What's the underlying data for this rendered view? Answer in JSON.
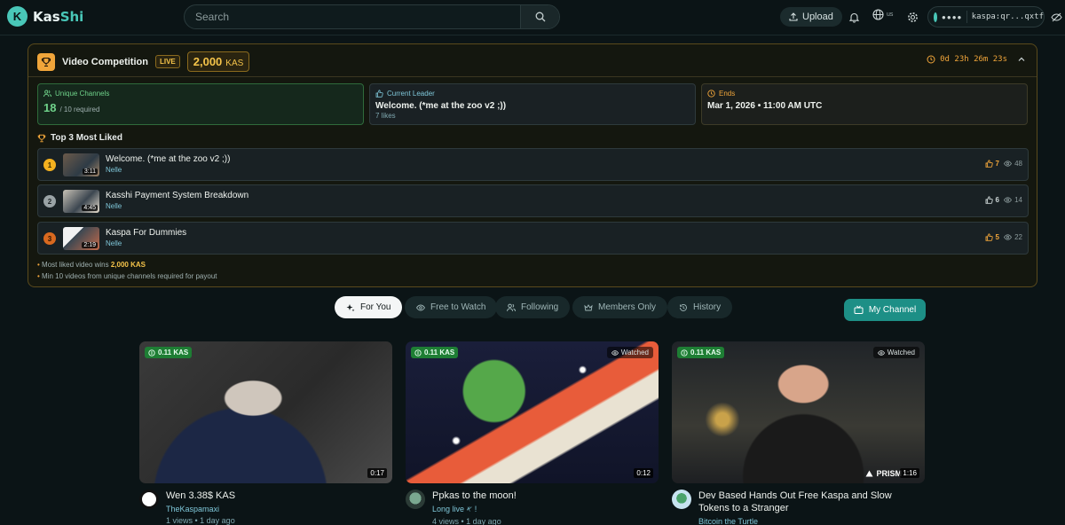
{
  "app": {
    "name_part1": "Kas",
    "name_part2": "Shi",
    "accent": "#49c7b8"
  },
  "header": {
    "search_placeholder": "Search",
    "upload_label": "Upload",
    "lang_code": "us",
    "wallet_dots": "●●●●",
    "wallet_address": "kaspa:qr...qxtf"
  },
  "competition": {
    "title": "Video Competition",
    "live_badge": "LIVE",
    "prize_amount": "2,000",
    "prize_unit": "KAS",
    "countdown": "0d 23h 26m 23s",
    "unique_channels_label": "Unique Channels",
    "unique_channels_value": "18",
    "unique_channels_required": "/ 10 required",
    "leader_label": "Current Leader",
    "leader_title": "Welcome. (*me at the zoo v2 ;))",
    "leader_likes": "7 likes",
    "ends_label": "Ends",
    "ends_value": "Mar 1, 2026 • 11:00 AM UTC",
    "top3_title": "Top 3 Most Liked",
    "top3": [
      {
        "rank": "1",
        "title": "Welcome. (*me at the zoo v2 ;))",
        "author": "Nelle",
        "duration": "3:11",
        "likes": "7",
        "views": "48"
      },
      {
        "rank": "2",
        "title": "Kasshi Payment System Breakdown",
        "author": "Nelle",
        "duration": "4:45",
        "likes": "6",
        "views": "14"
      },
      {
        "rank": "3",
        "title": "Kaspa For Dummies",
        "author": "Nelle",
        "duration": "2:19",
        "likes": "5",
        "views": "22"
      }
    ],
    "note1_prefix": "Most liked video wins ",
    "note1_bold": "2,000 KAS",
    "note2": "Min 10 videos from unique channels required for payout"
  },
  "tabs": [
    {
      "label": "For You",
      "icon": "sparkles-icon"
    },
    {
      "label": "Free to Watch",
      "icon": "eye-icon"
    },
    {
      "label": "Following",
      "icon": "users-icon"
    },
    {
      "label": "Members Only",
      "icon": "crown-icon"
    },
    {
      "label": "History",
      "icon": "history-icon"
    }
  ],
  "my_channel_label": "My Channel",
  "videos": [
    {
      "price": "0.11 KAS",
      "duration": "0:17",
      "title": "Wen 3.38$ KAS",
      "author": "TheKaspamaxi",
      "stats": "1 views • 1 day ago",
      "watched": ""
    },
    {
      "price": "0.11 KAS",
      "duration": "0:12",
      "title": "Ppkas to the moon!",
      "author": "Long live 𐤀 !",
      "stats": "4 views • 1 day ago",
      "watched": "Watched"
    },
    {
      "price": "0.11 KAS",
      "duration": "1:16",
      "title": "Dev Based Hands Out Free Kaspa and Slow Tokens to a Stranger",
      "author": "Bitcoin the Turtle",
      "stats": "",
      "watched": "Watched",
      "overlay_logo": "PRISM"
    }
  ]
}
